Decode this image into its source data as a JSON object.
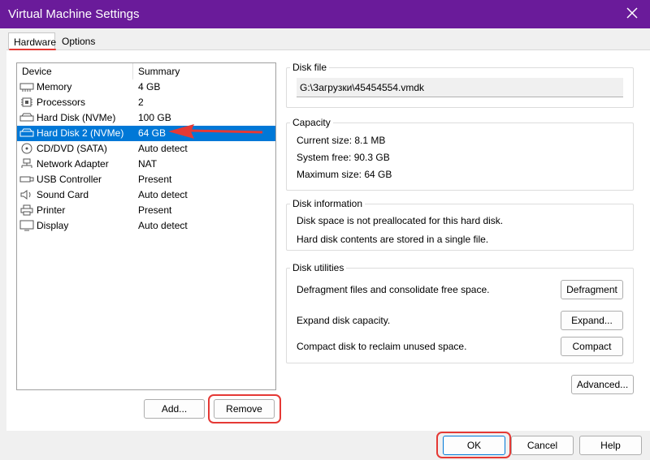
{
  "window": {
    "title": "Virtual Machine Settings"
  },
  "tabs": {
    "hardware": "Hardware",
    "options": "Options"
  },
  "device_list": {
    "col_device": "Device",
    "col_summary": "Summary",
    "items": [
      {
        "icon": "memory-icon",
        "name": "Memory",
        "summary": "4 GB"
      },
      {
        "icon": "processor-icon",
        "name": "Processors",
        "summary": "2"
      },
      {
        "icon": "hard-disk-icon",
        "name": "Hard Disk (NVMe)",
        "summary": "100 GB"
      },
      {
        "icon": "hard-disk-icon",
        "name": "Hard Disk 2 (NVMe)",
        "summary": "64 GB",
        "selected": true
      },
      {
        "icon": "cd-dvd-icon",
        "name": "CD/DVD (SATA)",
        "summary": "Auto detect"
      },
      {
        "icon": "network-adapter-icon",
        "name": "Network Adapter",
        "summary": "NAT"
      },
      {
        "icon": "usb-icon",
        "name": "USB Controller",
        "summary": "Present"
      },
      {
        "icon": "sound-card-icon",
        "name": "Sound Card",
        "summary": "Auto detect"
      },
      {
        "icon": "printer-icon",
        "name": "Printer",
        "summary": "Present"
      },
      {
        "icon": "display-icon",
        "name": "Display",
        "summary": "Auto detect"
      }
    ]
  },
  "list_buttons": {
    "add": "Add...",
    "remove": "Remove"
  },
  "disk_file": {
    "label": "Disk file",
    "value": "G:\\Загрузки\\45454554.vmdk"
  },
  "capacity": {
    "label": "Capacity",
    "current_size": "Current size: 8.1 MB",
    "system_free": "System free: 90.3 GB",
    "maximum_size": "Maximum size: 64 GB"
  },
  "disk_information": {
    "label": "Disk information",
    "line1": "Disk space is not preallocated for this hard disk.",
    "line2": "Hard disk contents are stored in a single file."
  },
  "disk_utilities": {
    "label": "Disk utilities",
    "defrag_text": "Defragment files and consolidate free space.",
    "defrag_button": "Defragment",
    "expand_text": "Expand disk capacity.",
    "expand_button": "Expand...",
    "compact_text": "Compact disk to reclaim unused space.",
    "compact_button": "Compact"
  },
  "advanced_button": "Advanced...",
  "footer": {
    "ok": "OK",
    "cancel": "Cancel",
    "help": "Help"
  },
  "colors": {
    "titlebar": "#6a1b9a",
    "selection": "#0078d7",
    "annotation": "#e53935"
  }
}
